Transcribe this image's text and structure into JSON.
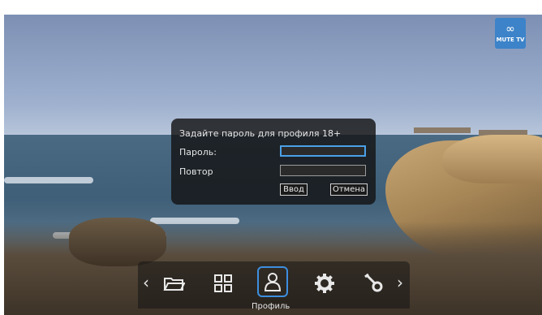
{
  "logo": {
    "mark": "∞",
    "text": "MUTE TV"
  },
  "dialog": {
    "title": "Задайте пароль для профиля 18+",
    "password_label": "Пароль:",
    "repeat_label": "Повтор",
    "password_value": "",
    "repeat_value": "",
    "enter_button": "Ввод",
    "cancel_button": "Отмена"
  },
  "menu": {
    "left_arrow": "‹",
    "right_arrow": "›",
    "items": [
      {
        "icon": "folder-icon"
      },
      {
        "icon": "grid-icon"
      },
      {
        "icon": "profile-icon",
        "label": "Профиль",
        "active": true
      },
      {
        "icon": "gear-icon"
      },
      {
        "icon": "tools-icon"
      }
    ],
    "caption": "Профиль"
  },
  "colors": {
    "accent": "#3d8fe0",
    "logo_bg": "#3c83c9"
  }
}
